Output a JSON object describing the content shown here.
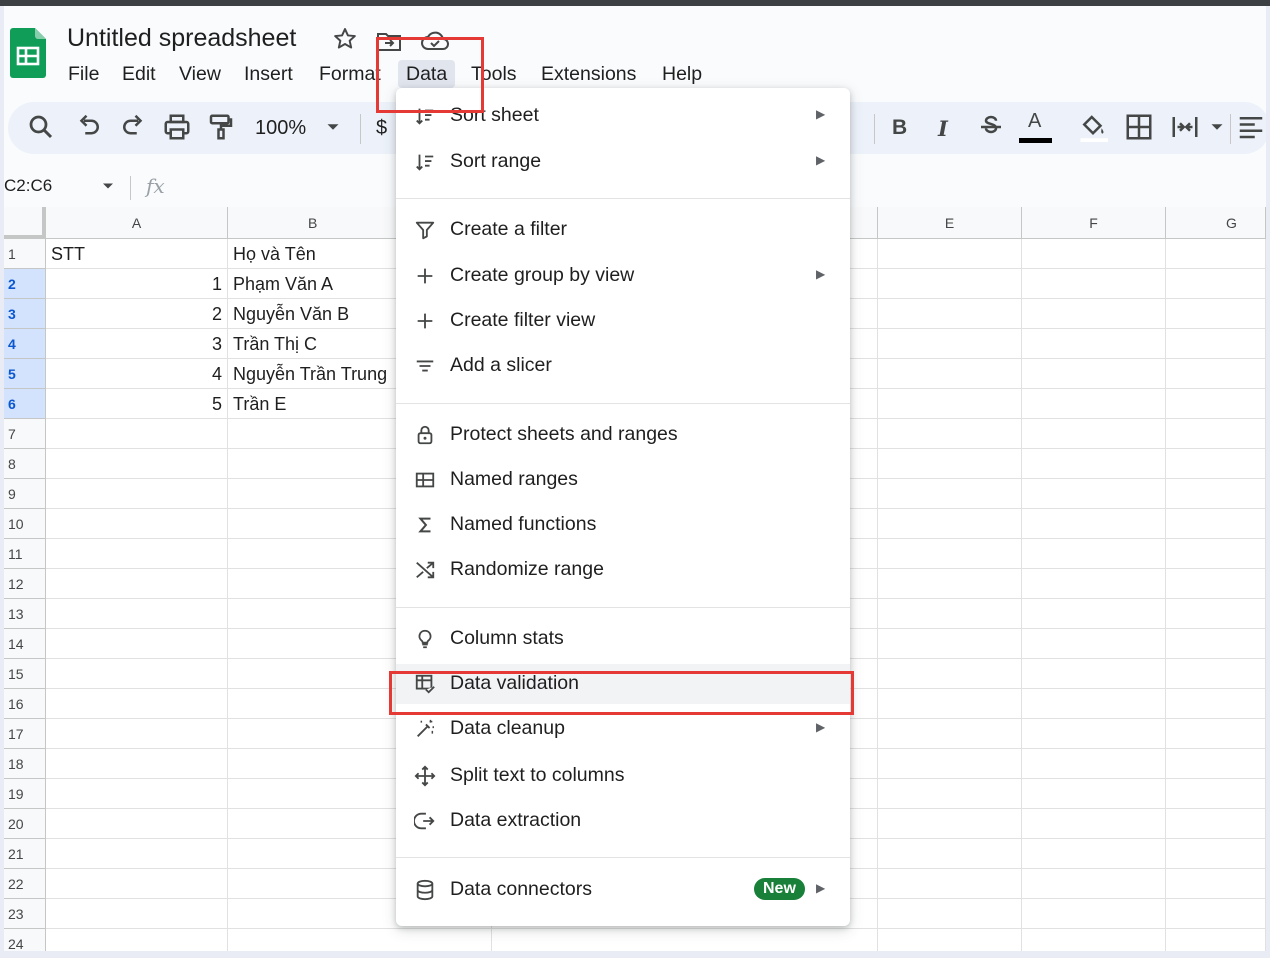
{
  "app": {
    "title": "Untitled spreadsheet",
    "accent": "#0f9d58",
    "highlight_color": "#e53935",
    "menu": [
      "File",
      "Edit",
      "View",
      "Insert",
      "Format",
      "Data",
      "Tools",
      "Extensions",
      "Help"
    ],
    "active_menu": "Data"
  },
  "toolbar": {
    "zoom": "100%",
    "currency": "$",
    "bold": "B",
    "italic": "I",
    "text_color_glyph": "A"
  },
  "formula_bar": {
    "name_box": "C2:C6",
    "fx": "fx"
  },
  "sheet": {
    "columns": [
      "A",
      "B",
      "E",
      "F",
      "G"
    ],
    "row_numbers": [
      "1",
      "2",
      "3",
      "4",
      "5",
      "6",
      "7",
      "8",
      "9",
      "10",
      "11",
      "12",
      "13",
      "14",
      "15",
      "16",
      "17",
      "18",
      "19",
      "20",
      "21",
      "22",
      "23",
      "24"
    ],
    "rows": [
      {
        "a": "STT",
        "b": "Họ và Tên"
      },
      {
        "a": "1",
        "b": "Phạm Văn A"
      },
      {
        "a": "2",
        "b": "Nguyễn Văn B"
      },
      {
        "a": "3",
        "b": "Trần Thị C"
      },
      {
        "a": "4",
        "b": "Nguyễn Trần Trung"
      },
      {
        "a": "5",
        "b": "Trần E"
      }
    ]
  },
  "data_menu": {
    "items": [
      {
        "label": "Sort sheet",
        "icon": "sort-icon",
        "submenu": true
      },
      {
        "label": "Sort range",
        "icon": "sort-icon",
        "submenu": true
      },
      {
        "label": "Create a filter",
        "icon": "filter-icon",
        "submenu": false
      },
      {
        "label": "Create group by view",
        "icon": "plus-icon",
        "submenu": true
      },
      {
        "label": "Create filter view",
        "icon": "plus-icon",
        "submenu": false
      },
      {
        "label": "Add a slicer",
        "icon": "slicer-icon",
        "submenu": false
      },
      {
        "label": "Protect sheets and ranges",
        "icon": "lock-icon",
        "submenu": false
      },
      {
        "label": "Named ranges",
        "icon": "table-icon",
        "submenu": false
      },
      {
        "label": "Named functions",
        "icon": "sigma-icon",
        "submenu": false
      },
      {
        "label": "Randomize range",
        "icon": "shuffle-icon",
        "submenu": false
      },
      {
        "label": "Column stats",
        "icon": "bulb-icon",
        "submenu": false
      },
      {
        "label": "Data validation",
        "icon": "validation-icon",
        "submenu": false
      },
      {
        "label": "Data cleanup",
        "icon": "wand-icon",
        "submenu": true
      },
      {
        "label": "Split text to columns",
        "icon": "split-icon",
        "submenu": false
      },
      {
        "label": "Data extraction",
        "icon": "extract-icon",
        "submenu": false
      },
      {
        "label": "Data connectors",
        "icon": "database-icon",
        "submenu": true,
        "badge": "New"
      }
    ]
  }
}
